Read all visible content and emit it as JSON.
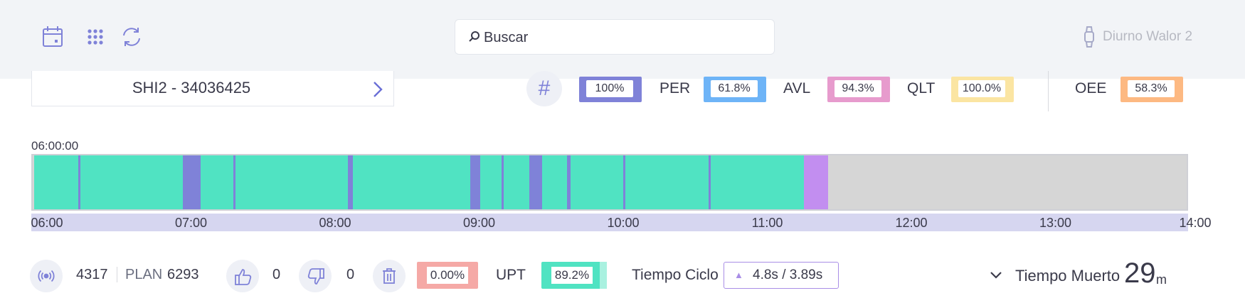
{
  "header": {
    "icons": [
      "calendar-icon",
      "grid-icon",
      "refresh-icon"
    ],
    "search_placeholder": "Buscar",
    "shift_label": "Diurno Walor 2"
  },
  "order": {
    "label": "SHI2 - 34036425"
  },
  "kpis": {
    "oee_total": {
      "value": "100%",
      "color": "#7f82d8"
    },
    "per": {
      "label": "PER",
      "value": "61.8%",
      "color": "#6eb4f7"
    },
    "avl": {
      "label": "AVL",
      "value": "94.3%",
      "color": "#e79bcd"
    },
    "qlt": {
      "label": "QLT",
      "value": "100.0%",
      "color": "#fbe5a2"
    },
    "oee": {
      "label": "OEE",
      "value": "58.3%",
      "color": "#fdb982"
    }
  },
  "timeline": {
    "start_label": "06:00:00",
    "ticks": [
      "06:00",
      "07:00",
      "08:00",
      "09:00",
      "10:00",
      "11:00",
      "12:00",
      "13:00",
      "14:00"
    ],
    "colors": {
      "running": "#50e3c2",
      "stop": "#7f82d8",
      "setup": "#c28ef0",
      "idle": "#d6d6d6"
    }
  },
  "footer": {
    "count": "4317",
    "plan_label": "PLAN",
    "plan_value": "6293",
    "good_count": "0",
    "bad_count": "0",
    "scrap_pct": "0.00%",
    "upt_label": "UPT",
    "upt_value": "89.2%",
    "ciclo_label": "Tiempo Ciclo",
    "ciclo_value": "4.8s / 3.89s",
    "muerto_label": "Tiempo Muerto",
    "muerto_value": "29",
    "muerto_unit": "m"
  }
}
